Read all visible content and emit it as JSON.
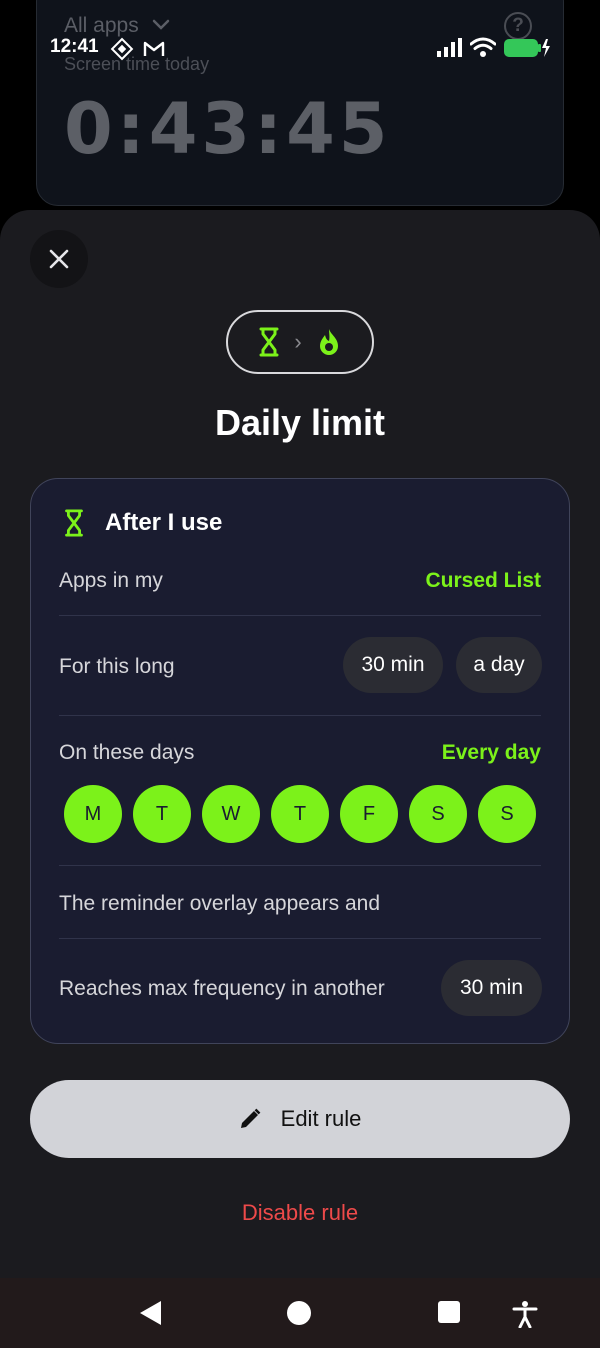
{
  "background": {
    "all_apps_label": "All apps",
    "subtitle": "Screen time today",
    "timer": "0:43:45"
  },
  "status_bar": {
    "time": "12:41",
    "battery_color": "#34c759"
  },
  "sheet": {
    "title": "Daily limit",
    "card": {
      "trigger_label": "After I use",
      "apps_label": "Apps in my",
      "apps_value": "Cursed List",
      "duration_label": "For this long",
      "duration_value": "30 min",
      "duration_period": "a day",
      "days_label": "On these days",
      "days_value": "Every day",
      "days": [
        "M",
        "T",
        "W",
        "T",
        "F",
        "S",
        "S"
      ],
      "reminder_label": "The reminder overlay appears and",
      "max_freq_label": "Reaches max frequency in another",
      "max_freq_value": "30 min"
    },
    "edit_button": "Edit rule",
    "disable_button": "Disable rule"
  },
  "colors": {
    "accent": "#7cf21a",
    "danger": "#ee4a4a",
    "card_bg": "#1a1c30",
    "sheet_bg": "#1b1b1f"
  },
  "icons": {
    "close": "close-icon",
    "hourglass": "hourglass-icon",
    "flame": "flame-icon",
    "pencil": "pencil-icon",
    "nav_back": "back-icon",
    "nav_home": "home-icon",
    "nav_recents": "recents-icon",
    "nav_accessibility": "accessibility-icon"
  }
}
